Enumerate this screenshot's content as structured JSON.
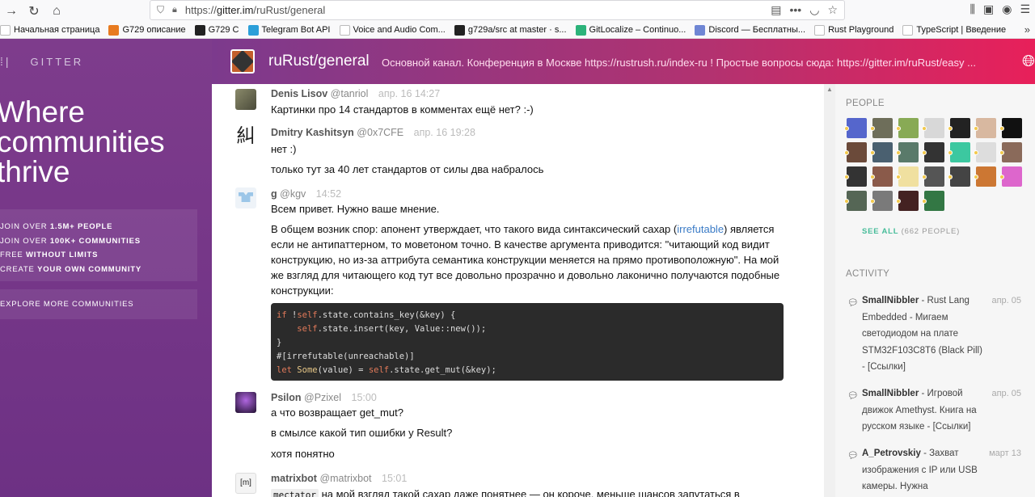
{
  "browser": {
    "url_prefix": "https://",
    "url_host": "gitter.im",
    "url_path": "/ruRust/general",
    "bookmarks": [
      {
        "label": "Начальная страница",
        "icon": "home-icon",
        "color": "#ffffff"
      },
      {
        "label": "G729 описание",
        "icon": "e-icon",
        "color": "#e87b20"
      },
      {
        "label": "G729 C",
        "icon": "github-icon",
        "color": "#222222"
      },
      {
        "label": "Telegram Bot API",
        "icon": "telegram-icon",
        "color": "#2c9fd9"
      },
      {
        "label": "Voice and Audio Com...",
        "icon": "google-icon",
        "color": "#ffffff"
      },
      {
        "label": "g729a/src at master · s...",
        "icon": "github-icon",
        "color": "#222222"
      },
      {
        "label": "GitLocalize – Continuo...",
        "icon": "gitlocalize-icon",
        "color": "#2cb37a"
      },
      {
        "label": "Discord — Бесплатны...",
        "icon": "discord-icon",
        "color": "#6f86d4"
      },
      {
        "label": "Rust Playground",
        "icon": "globe-icon",
        "color": "#ffffff"
      },
      {
        "label": "TypeScript | Введение",
        "icon": "typescript-icon",
        "color": "#ffffff"
      }
    ]
  },
  "left": {
    "logo": "GITTER",
    "tagline": [
      "Where",
      "communities",
      "thrive"
    ],
    "join": [
      {
        "pre": "JOIN OVER ",
        "bold": "1.5M+ PEOPLE",
        "post": ""
      },
      {
        "pre": "JOIN OVER ",
        "bold": "100K+ COMMUNITIES",
        "post": ""
      },
      {
        "pre": "FREE ",
        "bold": "WITHOUT LIMITS",
        "post": ""
      },
      {
        "pre": "CREATE ",
        "bold": "YOUR OWN COMMUNITY",
        "post": ""
      }
    ],
    "explore": "EXPLORE MORE COMMUNITIES"
  },
  "header": {
    "room": "ruRust/general",
    "topic": "Основной канал. Конференция в Москве https://rustrush.ru/index-ru ! Простые вопросы сюда: https://gitter.im/ruRust/easy ..."
  },
  "messages": {
    "m1": {
      "name": "Denis Lisov",
      "user": "@tanriol",
      "time": "апр. 16 14:27",
      "text": "Картинки про 14 стандартов в комментах ещё нет? :-)"
    },
    "m2": {
      "name": "Dmitry Kashitsyn",
      "user": "@0x7CFE",
      "time": "апр. 16 19:28",
      "avatar_glyph": "糾",
      "text1": "нет :)",
      "text2": "только тут за 40 лет стандартов от силы два набралось"
    },
    "m3": {
      "name": "g",
      "user": "@kgv",
      "time": "14:52",
      "text1": "Всем привет. Нужно ваше мнение.",
      "para_pre": "В общем возник спор: апонент утверждает, что такого вида синтаксический сахар (",
      "para_link": "irrefutable",
      "para_post": ") является если не антипаттерном, то моветоном точно. В качестве аргумента приводится: \"читающий код видит конструкцию, но из-за аттрибута семантика конструкции меняется на прямо противоположную\". На мой же взгляд для читающего код тут все довольно прозрачно и довольно лаконично получаются подобные конструкции:",
      "code": {
        "l1a": "if",
        "l1b": " !",
        "l1c": "self",
        "l1d": ".state.contains_key(&key) {",
        "l2a": "    ",
        "l2b": "self",
        "l2c": ".state.insert(key, Value::new());",
        "l3": "}",
        "l4": "#[irrefutable(unreachable)]",
        "l5a": "let",
        "l5b": " ",
        "l5c": "Some",
        "l5d": "(value) = ",
        "l5e": "self",
        "l5f": ".state.get_mut(&key);"
      }
    },
    "m4": {
      "name": "Psilon",
      "user": "@Pzixel",
      "time": "15:00",
      "text1": "а что возвращает get_mut?",
      "text2": "в смылсе какой тип ошибки у Result?",
      "text3": "хотя понятно"
    },
    "m5": {
      "name": "matrixbot",
      "user": "@matrixbot",
      "time": "15:01",
      "avatar_glyph": "[m]",
      "code_word": "mectator",
      "text": " на мой взгляд такой сахар даже понятнее — он короче, меньше шансов запутаться в"
    }
  },
  "sidebar": {
    "people_title": "PEOPLE",
    "see_all": "SEE ALL",
    "count": "(662 PEOPLE)",
    "activity_title": "ACTIVITY",
    "activity": [
      {
        "user": "SmallNibbler",
        "text": " - Rust Lang Embedded - Мигаем светодиодом на плате STM32F103C8T6 (Black Pill) - [Ссылки]",
        "date": "апр. 05"
      },
      {
        "user": "SmallNibbler",
        "text": " - Игровой движок Amethyst. Книга на русском языке - [Ссылки]",
        "date": "апр. 05"
      },
      {
        "user": "A_Petrovskiy",
        "text": " - Захват изображения с IP или USB камеры. Нужна консултация",
        "date": "март 13"
      }
    ],
    "avatar_colors": [
      "#5566cc",
      "#6e6e5a",
      "#88aa55",
      "#d8d8d8",
      "#222222",
      "#d8b8a0",
      "#111111",
      "#6b4a3a",
      "#4a6070",
      "#5a7a6a",
      "#333333",
      "#3cc8a0",
      "#dddddd",
      "#8a6a5a",
      "#333333",
      "#8a5a4a",
      "#f0e0a0",
      "#555555",
      "#444444",
      "#cc7733",
      "#dd66cc",
      "#556655",
      "#7a7a7a",
      "#442222",
      "#337744"
    ]
  }
}
